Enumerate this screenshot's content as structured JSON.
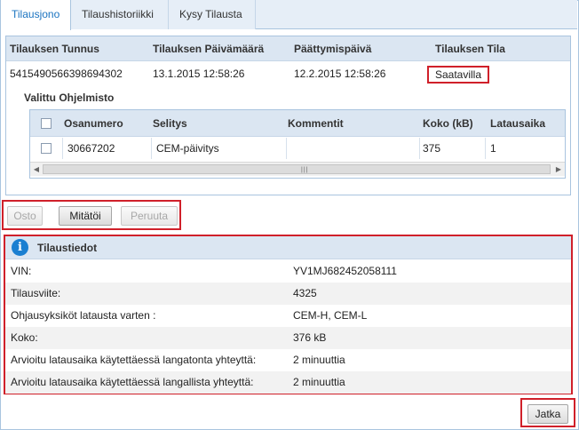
{
  "tabs": [
    {
      "label": "Tilausjono",
      "active": true
    },
    {
      "label": "Tilaushistoriikki",
      "active": false
    },
    {
      "label": "Kysy Tilausta",
      "active": false
    }
  ],
  "order": {
    "columns": [
      "Tilauksen Tunnus",
      "Tilauksen Päivämäärä",
      "Päättymispäivä",
      "Tilauksen Tila"
    ],
    "row": {
      "id": "5415490566398694302",
      "date": "13.1.2015 12:58:26",
      "end_date": "12.2.2015 12:58:26",
      "status": "Saatavilla"
    }
  },
  "software": {
    "label": "Valittu Ohjelmisto",
    "columns": [
      "Osanumero",
      "Selitys",
      "Kommentit",
      "Koko (kB)",
      "Latausaika"
    ],
    "row": {
      "part_number": "30667202",
      "description": "CEM-päivitys",
      "comments": "",
      "size": "375",
      "download_time": "1"
    }
  },
  "actions": {
    "buy": "Osto",
    "void": "Mitätöi",
    "cancel": "Peruuta"
  },
  "info": {
    "title": "Tilaustiedot",
    "rows": [
      {
        "label": "VIN:",
        "value": "YV1MJ682452058111"
      },
      {
        "label": "Tilausviite:",
        "value": "4325"
      },
      {
        "label": "Ohjausyksiköt latausta varten :",
        "value": "CEM-H, CEM-L"
      },
      {
        "label": "Koko:",
        "value": "376 kB"
      },
      {
        "label": "Arvioitu latausaika käytettäessä langatonta yhteyttä:",
        "value": "2 minuuttia"
      },
      {
        "label": "Arvioitu latausaika käytettäessä langallista yhteyttä:",
        "value": "2 minuuttia"
      }
    ]
  },
  "continue_label": "Jatka",
  "colors": {
    "accent": "#1a73c0",
    "highlight": "#d0202a",
    "header_bg": "#dbe6f2"
  }
}
